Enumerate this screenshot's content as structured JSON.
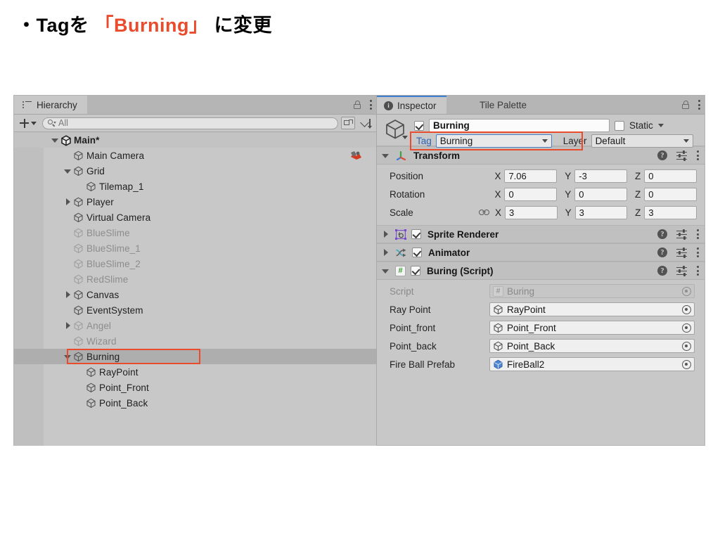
{
  "slide": {
    "bullet": "・",
    "text_before": "Tagを",
    "highlight": "「Burning」",
    "text_after": "に変更",
    "highlight_color": "#ea4b2d"
  },
  "hierarchy": {
    "tab_label": "Hierarchy",
    "toolbar": {
      "search_placeholder": "All",
      "add_label": "+"
    },
    "items": [
      {
        "label": "Main*",
        "indent": 0,
        "twist": "down",
        "bold": true,
        "dim": false,
        "selected": false,
        "icon": "unity-scene-icon"
      },
      {
        "label": "Main Camera",
        "indent": 1,
        "twist": "none",
        "bold": false,
        "dim": false,
        "selected": false,
        "icon": "gameobject-cube-icon",
        "right_icon": "camera-icon"
      },
      {
        "label": "Grid",
        "indent": 1,
        "twist": "down",
        "bold": false,
        "dim": false,
        "selected": false,
        "icon": "gameobject-cube-icon"
      },
      {
        "label": "Tilemap_1",
        "indent": 2,
        "twist": "none",
        "bold": false,
        "dim": false,
        "selected": false,
        "icon": "gameobject-cube-icon"
      },
      {
        "label": "Player",
        "indent": 1,
        "twist": "right",
        "bold": false,
        "dim": false,
        "selected": false,
        "icon": "gameobject-cube-icon"
      },
      {
        "label": "Virtual Camera",
        "indent": 1,
        "twist": "none",
        "bold": false,
        "dim": false,
        "selected": false,
        "icon": "gameobject-cube-icon"
      },
      {
        "label": "BlueSlime",
        "indent": 1,
        "twist": "none",
        "bold": false,
        "dim": true,
        "selected": false,
        "icon": "gameobject-cube-icon"
      },
      {
        "label": "BlueSlime_1",
        "indent": 1,
        "twist": "none",
        "bold": false,
        "dim": true,
        "selected": false,
        "icon": "gameobject-cube-icon"
      },
      {
        "label": "BlueSlime_2",
        "indent": 1,
        "twist": "none",
        "bold": false,
        "dim": true,
        "selected": false,
        "icon": "gameobject-cube-icon"
      },
      {
        "label": "RedSlime",
        "indent": 1,
        "twist": "none",
        "bold": false,
        "dim": true,
        "selected": false,
        "icon": "gameobject-cube-icon"
      },
      {
        "label": "Canvas",
        "indent": 1,
        "twist": "right",
        "bold": false,
        "dim": false,
        "selected": false,
        "icon": "gameobject-cube-icon"
      },
      {
        "label": "EventSystem",
        "indent": 1,
        "twist": "none",
        "bold": false,
        "dim": false,
        "selected": false,
        "icon": "gameobject-cube-icon"
      },
      {
        "label": "Angel",
        "indent": 1,
        "twist": "right",
        "bold": false,
        "dim": true,
        "selected": false,
        "icon": "gameobject-cube-icon"
      },
      {
        "label": "Wizard",
        "indent": 1,
        "twist": "none",
        "bold": false,
        "dim": true,
        "selected": false,
        "icon": "gameobject-cube-icon"
      },
      {
        "label": "Burning",
        "indent": 1,
        "twist": "down",
        "bold": false,
        "dim": false,
        "selected": true,
        "icon": "gameobject-cube-icon"
      },
      {
        "label": "RayPoint",
        "indent": 2,
        "twist": "none",
        "bold": false,
        "dim": false,
        "selected": false,
        "icon": "gameobject-cube-icon"
      },
      {
        "label": "Point_Front",
        "indent": 2,
        "twist": "none",
        "bold": false,
        "dim": false,
        "selected": false,
        "icon": "gameobject-cube-icon"
      },
      {
        "label": "Point_Back",
        "indent": 2,
        "twist": "none",
        "bold": false,
        "dim": false,
        "selected": false,
        "icon": "gameobject-cube-icon"
      }
    ]
  },
  "inspector": {
    "tabs": [
      {
        "label": "Inspector",
        "active": true,
        "icon": "info-icon"
      },
      {
        "label": "Tile Palette",
        "active": false,
        "icon": "none"
      }
    ],
    "object_header": {
      "enabled": true,
      "name": "Burning",
      "static_label": "Static",
      "static_checked": false,
      "tag_label": "Tag",
      "tag_value": "Burning",
      "layer_label": "Layer",
      "layer_value": "Default"
    },
    "transform": {
      "title": "Transform",
      "expanded": true,
      "rows": [
        {
          "name": "Position",
          "x": "7.06",
          "y": "-3",
          "z": "0",
          "linked": false
        },
        {
          "name": "Rotation",
          "x": "0",
          "y": "0",
          "z": "0",
          "linked": false
        },
        {
          "name": "Scale",
          "x": "3",
          "y": "3",
          "z": "3",
          "linked": true
        }
      ],
      "axis_labels": {
        "x": "X",
        "y": "Y",
        "z": "Z"
      }
    },
    "components": [
      {
        "title": "Sprite Renderer",
        "expanded": false,
        "enabled": true,
        "icon": "sprite-renderer-icon"
      },
      {
        "title": "Animator",
        "expanded": false,
        "enabled": true,
        "icon": "animator-icon"
      },
      {
        "title": "Buring (Script)",
        "expanded": true,
        "enabled": true,
        "icon": "cs-script-icon"
      }
    ],
    "script_fields": [
      {
        "name": "Script",
        "value": "Buring",
        "icon": "cs-script-icon",
        "disabled": true
      },
      {
        "name": "Ray Point",
        "value": "RayPoint",
        "icon": "gameobject-cube-icon",
        "disabled": false
      },
      {
        "name": "Point_front",
        "value": "Point_Front",
        "icon": "gameobject-cube-icon",
        "disabled": false
      },
      {
        "name": "Point_back",
        "value": "Point_Back",
        "icon": "gameobject-cube-icon",
        "disabled": false
      },
      {
        "name": "Fire Ball Prefab",
        "value": "FireBall2",
        "icon": "prefab-cube-icon",
        "disabled": false
      }
    ]
  }
}
